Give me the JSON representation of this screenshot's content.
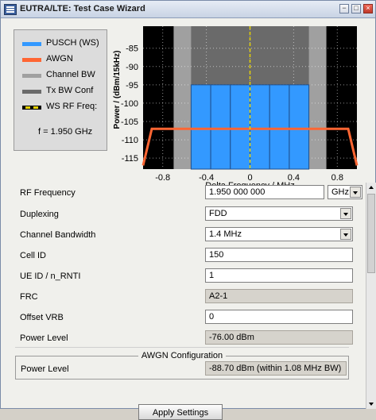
{
  "window": {
    "title": "EUTRA/LTE: Test Case Wizard",
    "controls": {
      "minimize": "−",
      "maximize": "□",
      "close": "×"
    }
  },
  "legend": {
    "items": [
      {
        "label": "PUSCH (WS)",
        "color": "#3399ff"
      },
      {
        "label": "AWGN",
        "color": "#ff6633"
      },
      {
        "label": "Channel BW",
        "color": "#a0a0a0"
      },
      {
        "label": "Tx BW Conf",
        "color": "#6a6a6a"
      },
      {
        "label": "WS RF Freq:",
        "color": "#e6d200"
      }
    ],
    "freq_text": "f = 1.950 GHz"
  },
  "chart_data": {
    "type": "bar",
    "title": "",
    "xlabel": "Delta Frequency / MHz",
    "ylabel": "Power / (dBm/15kHz)",
    "xlim": [
      -0.98,
      0.98
    ],
    "ylim": [
      -118,
      -79
    ],
    "x_ticks": [
      -0.8,
      -0.4,
      0,
      0.4,
      0.8
    ],
    "y_ticks": [
      -85,
      -90,
      -95,
      -100,
      -105,
      -110,
      -115
    ],
    "channel_bw": [
      -0.7,
      0.7
    ],
    "tx_bw_conf": [
      -0.54,
      0.54
    ],
    "series": [
      {
        "name": "PUSCH (WS)",
        "type": "bar",
        "x_edges": [
          -0.54,
          -0.36,
          -0.18,
          0,
          0.18,
          0.36,
          0.54
        ],
        "values": [
          -95,
          -95,
          -95,
          -95,
          -95,
          -95
        ]
      },
      {
        "name": "AWGN",
        "type": "line",
        "points": [
          [
            -0.98,
            -117
          ],
          [
            -0.9,
            -107
          ],
          [
            0.9,
            -107
          ],
          [
            0.98,
            -117
          ]
        ]
      },
      {
        "name": "WS RF Freq:",
        "type": "vline",
        "x": 0
      }
    ],
    "grid": true,
    "legend_placement": "left"
  },
  "form": {
    "rows": [
      {
        "label": "RF Frequency",
        "value": "1.950 000 000",
        "unit": "GHz"
      },
      {
        "label": "Duplexing",
        "value": "FDD"
      },
      {
        "label": "Channel Bandwidth",
        "value": "1.4 MHz"
      },
      {
        "label": "Cell ID",
        "value": "150"
      },
      {
        "label": "UE ID / n_RNTI",
        "value": "1"
      },
      {
        "label": "FRC",
        "value": "A2-1"
      },
      {
        "label": "Offset VRB",
        "value": "0"
      },
      {
        "label": "Power Level",
        "value": "-76.00 dBm"
      }
    ],
    "awgn": {
      "title": "AWGN Configuration",
      "label": "Power Level",
      "value": "-88.70 dBm (within 1.08 MHz BW)"
    },
    "apply_label": "Apply Settings"
  }
}
